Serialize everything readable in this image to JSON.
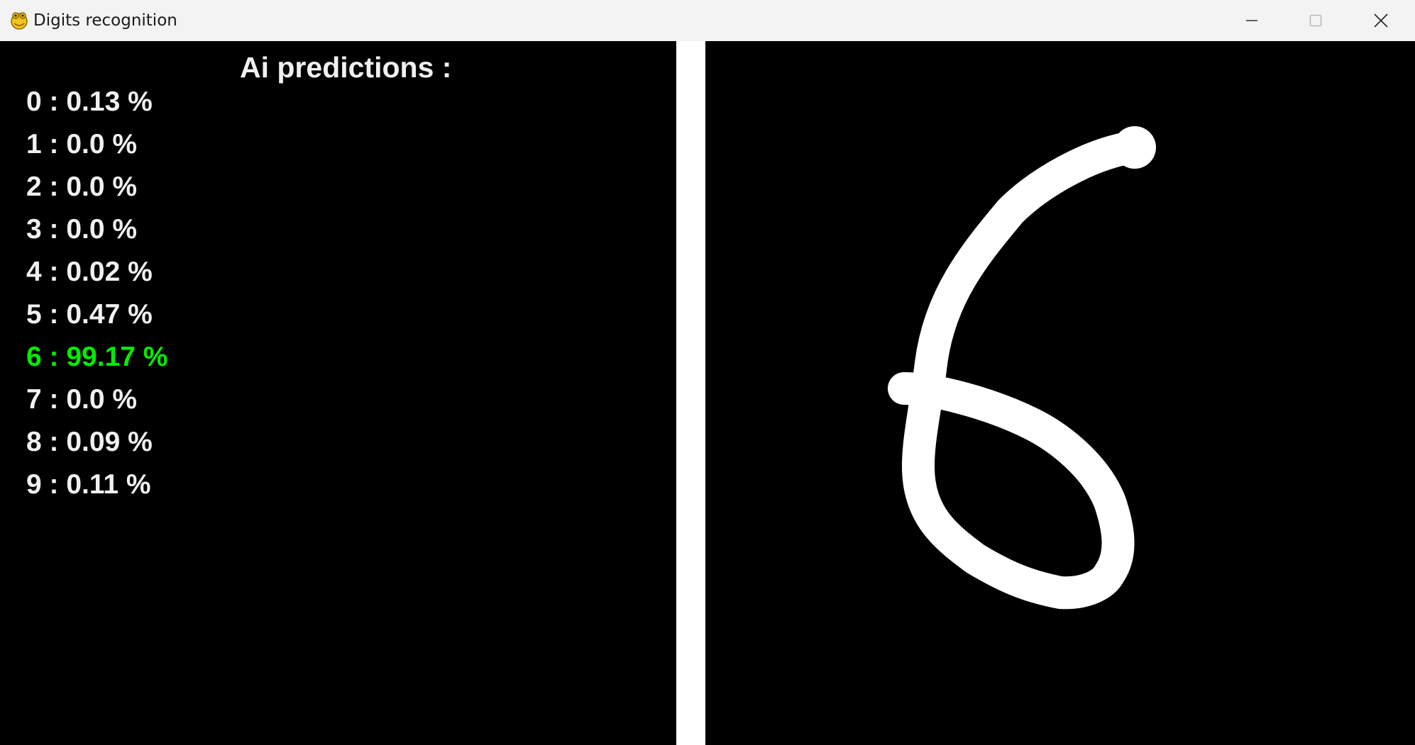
{
  "window": {
    "title": "Digits recognition",
    "app_icon": "pygame-snake-icon",
    "controls": {
      "minimize_icon": "minimize-icon",
      "maximize_icon": "maximize-icon",
      "close_icon": "close-icon"
    }
  },
  "predictions": {
    "title": "Ai predictions :",
    "highlight_color": "#00ee00",
    "text_color": "#f0f0f0",
    "items": [
      {
        "label": "0 : 0.13 %",
        "digit": 0,
        "percent": 0.13
      },
      {
        "label": "1 : 0.0 %",
        "digit": 1,
        "percent": 0.0
      },
      {
        "label": "2 : 0.0 %",
        "digit": 2,
        "percent": 0.0
      },
      {
        "label": "3 : 0.0 %",
        "digit": 3,
        "percent": 0.0
      },
      {
        "label": "4 : 0.02 %",
        "digit": 4,
        "percent": 0.02
      },
      {
        "label": "5 : 0.47 %",
        "digit": 5,
        "percent": 0.47
      },
      {
        "label": "6 : 99.17 %",
        "digit": 6,
        "percent": 99.17
      },
      {
        "label": "7 : 0.0 %",
        "digit": 7,
        "percent": 0.0
      },
      {
        "label": "8 : 0.09 %",
        "digit": 8,
        "percent": 0.09
      },
      {
        "label": "9 : 0.11 %",
        "digit": 9,
        "percent": 0.11
      }
    ]
  },
  "drawing_canvas": {
    "background": "#000000",
    "stroke_color": "#ffffff",
    "drawn_digit": "6"
  }
}
